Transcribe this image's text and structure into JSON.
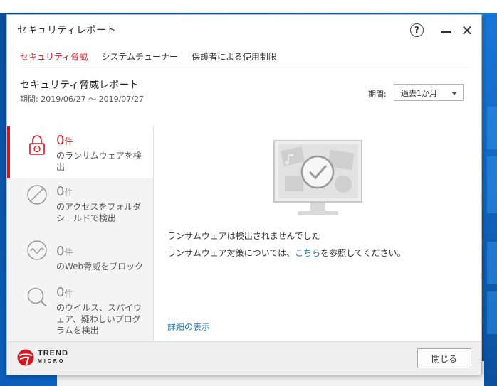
{
  "window": {
    "title": "セキュリティレポート",
    "help_glyph": "?"
  },
  "tabs": [
    {
      "label": "セキュリティ脅威",
      "active": true
    },
    {
      "label": "システムチューナー",
      "active": false
    },
    {
      "label": "保護者による使用制限",
      "active": false
    }
  ],
  "report": {
    "title": "セキュリティ脅威レポート",
    "period": "期間: 2019/06/27 ～ 2019/07/27"
  },
  "period_filter": {
    "label": "期間:",
    "selected": "過去1か月"
  },
  "threats": [
    {
      "count": "0",
      "unit": "件",
      "desc": "のランサムウェアを検出",
      "icon": "ransomware-lock-icon"
    },
    {
      "count": "0",
      "unit": "件",
      "desc": "のアクセスをフォルダシールドで検出",
      "icon": "folder-shield-icon"
    },
    {
      "count": "0",
      "unit": "件",
      "desc": "のWeb脅威をブロック",
      "icon": "web-threat-icon"
    },
    {
      "count": "0",
      "unit": "件",
      "desc": "のウイルス、スパイウェア、疑わしいプログラムを検出",
      "icon": "search-icon"
    }
  ],
  "main": {
    "message1": "ランサムウェアは検出されませんでした",
    "message2_prefix": "ランサムウェア対策については、",
    "message2_link": "こちら",
    "message2_suffix": "を参照してください。",
    "details_link": "詳細の表示"
  },
  "footer": {
    "brand_line1": "TREND",
    "brand_line2": "MICRO",
    "close_label": "閉じる"
  },
  "colors": {
    "accent": "#d7171f",
    "link": "#1a7bbf"
  }
}
